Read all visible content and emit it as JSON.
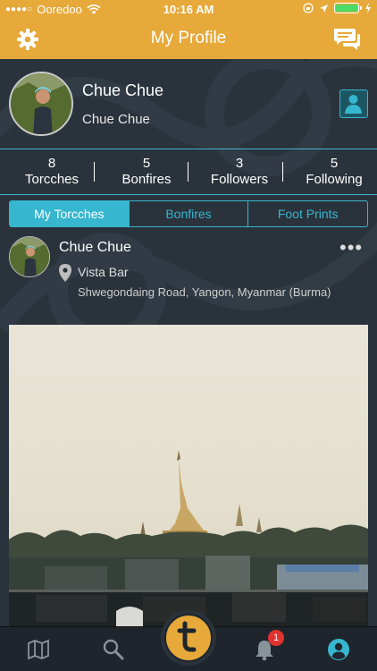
{
  "status_bar": {
    "carrier": "Ooredoo",
    "time": "10:16 AM",
    "signal_icon": "signal-dots-icon",
    "wifi_icon": "wifi-icon",
    "battery_color": "#4cd964"
  },
  "nav": {
    "title": "My Profile",
    "left_icon": "gear-icon",
    "right_icon": "chat-bubbles-icon",
    "bar_color": "#e6a93a"
  },
  "profile": {
    "display_name": "Chue Chue",
    "username": "Chue Chue",
    "contact_icon": "person-icon"
  },
  "stats": [
    {
      "value": "8",
      "label": "Torcches"
    },
    {
      "value": "5",
      "label": "Bonfires"
    },
    {
      "value": "3",
      "label": "Followers"
    },
    {
      "value": "5",
      "label": "Following"
    }
  ],
  "tabs": [
    {
      "label": "My Torcches",
      "active": true
    },
    {
      "label": "Bonfires",
      "active": false
    },
    {
      "label": "Foot Prints",
      "active": false
    }
  ],
  "post": {
    "author": "Chue Chue",
    "place": "Vista Bar",
    "address": "Shwegondaing Road, Yangon, Myanmar (Burma)",
    "more": "•••"
  },
  "tabbar": {
    "items": [
      "map-icon",
      "search-icon",
      "torcch-logo-icon",
      "bell-icon",
      "profile-icon"
    ],
    "notification_count": "1",
    "accent": "#37b6cf"
  }
}
